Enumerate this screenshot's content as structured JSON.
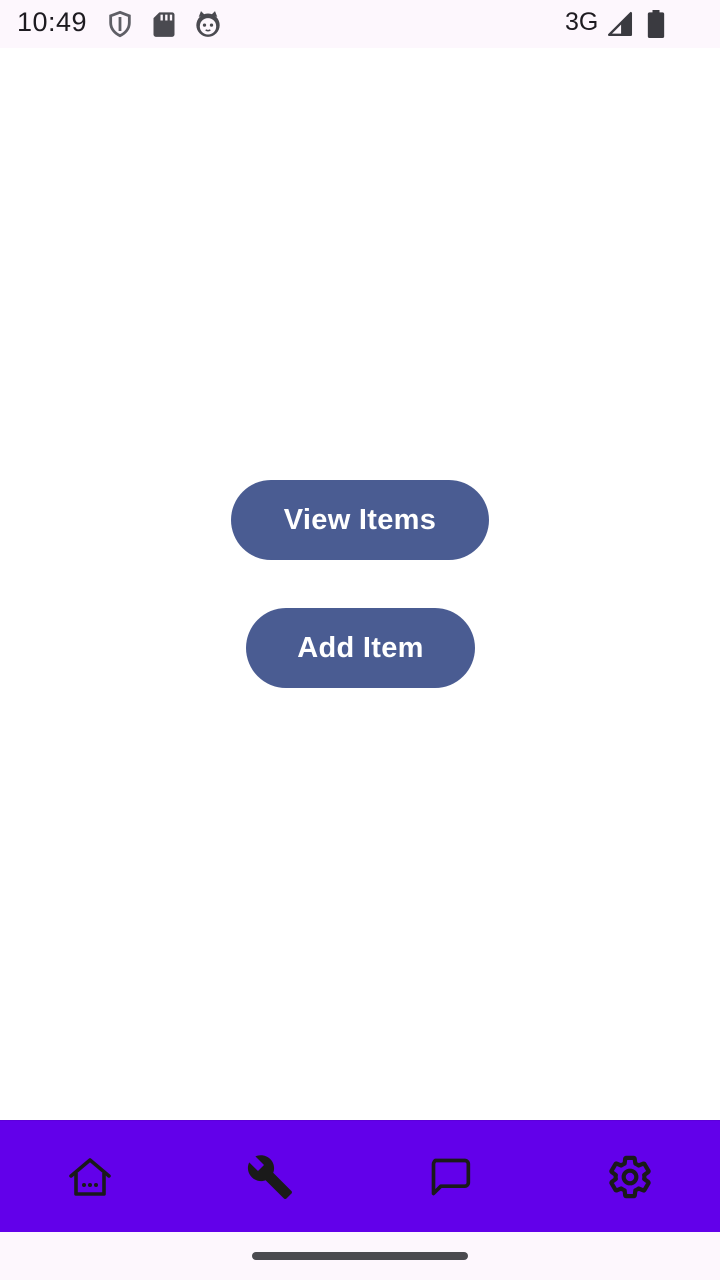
{
  "status_bar": {
    "time": "10:49",
    "network": "3G",
    "icons": [
      "shield-icon",
      "sd-card-icon",
      "cat-face-icon",
      "signal-icon",
      "battery-icon"
    ]
  },
  "main": {
    "view_items_label": "View Items",
    "add_item_label": "Add Item",
    "button_color": "#4a5c92"
  },
  "bottom_nav": {
    "background": "#6200ea",
    "items": [
      {
        "icon": "home-icon"
      },
      {
        "icon": "wrench-icon"
      },
      {
        "icon": "chat-icon"
      },
      {
        "icon": "settings-gear-icon"
      }
    ]
  }
}
